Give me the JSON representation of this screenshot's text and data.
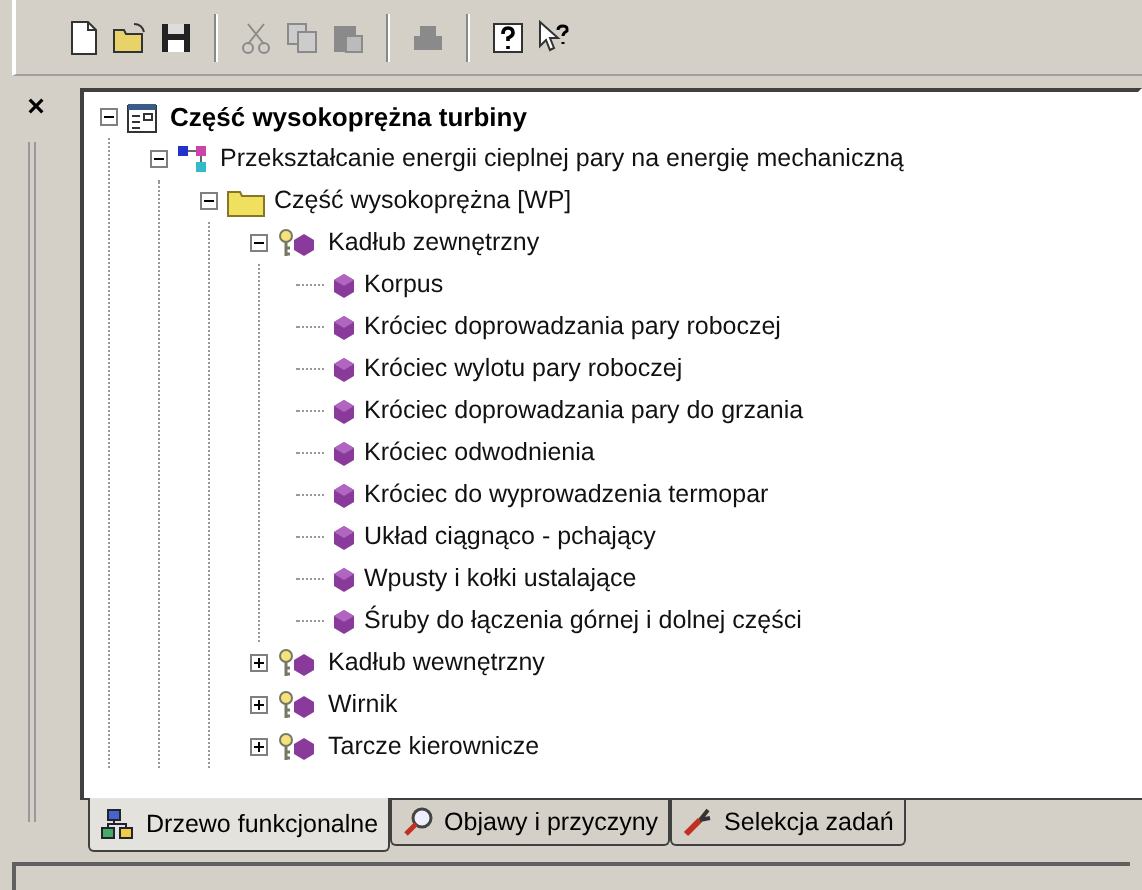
{
  "toolbar": [
    {
      "kind": "new",
      "disabled": false
    },
    {
      "kind": "open",
      "disabled": false
    },
    {
      "kind": "save",
      "disabled": false
    },
    {
      "kind": "separator",
      "disabled": false
    },
    {
      "kind": "cut",
      "disabled": true
    },
    {
      "kind": "copy",
      "disabled": true
    },
    {
      "kind": "paste",
      "disabled": true
    },
    {
      "kind": "separator",
      "disabled": false
    },
    {
      "kind": "print",
      "disabled": true
    },
    {
      "kind": "separator",
      "disabled": false
    },
    {
      "kind": "help",
      "disabled": false
    },
    {
      "kind": "context-help",
      "disabled": false
    }
  ],
  "panel": {
    "close": "×"
  },
  "tree": [
    {
      "kind": "root",
      "label": "Część wysokoprężna turbiny",
      "expanded": true,
      "children": [
        {
          "kind": "process",
          "label": "Przekształcanie energii cieplnej pary na energię mechaniczną",
          "expanded": true,
          "children": [
            {
              "kind": "folder",
              "label": "Część wysokoprężna [WP]",
              "expanded": true,
              "children": [
                {
                  "kind": "assembly",
                  "label": "Kadłub zewnętrzny",
                  "expanded": true,
                  "children": [
                    {
                      "kind": "part",
                      "label": "Korpus"
                    },
                    {
                      "kind": "part",
                      "label": "Króciec doprowadzania pary roboczej"
                    },
                    {
                      "kind": "part",
                      "label": "Króciec wylotu pary roboczej"
                    },
                    {
                      "kind": "part",
                      "label": "Króciec doprowadzania pary do grzania"
                    },
                    {
                      "kind": "part",
                      "label": "Króciec odwodnienia"
                    },
                    {
                      "kind": "part",
                      "label": "Króciec do wyprowadzenia termopar"
                    },
                    {
                      "kind": "part",
                      "label": "Układ ciągnąco - pchający"
                    },
                    {
                      "kind": "part",
                      "label": "Wpusty i kołki ustalające"
                    },
                    {
                      "kind": "part",
                      "label": "Śruby do łączenia górnej i dolnej części"
                    }
                  ]
                },
                {
                  "kind": "assembly",
                  "label": "Kadłub wewnętrzny",
                  "expanded": false
                },
                {
                  "kind": "assembly",
                  "label": "Wirnik",
                  "expanded": false
                },
                {
                  "kind": "assembly",
                  "label": "Tarcze kierownicze",
                  "expanded": false
                }
              ]
            }
          ]
        }
      ]
    }
  ],
  "tabs": [
    {
      "kind": "tree",
      "label": "Drzewo funkcjonalne",
      "selected": true
    },
    {
      "kind": "search",
      "label": "Objawy i przyczyny",
      "selected": false
    },
    {
      "kind": "tool",
      "label": "Selekcja zadań",
      "selected": false
    }
  ]
}
